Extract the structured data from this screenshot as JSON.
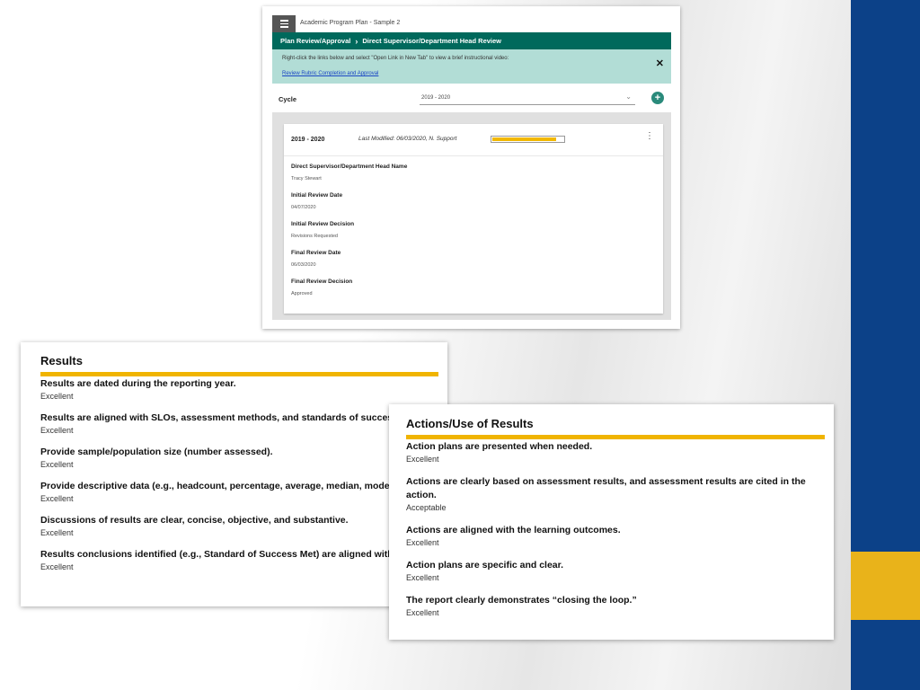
{
  "app": {
    "title": "Academic Program Plan - Sample 2",
    "breadcrumb": [
      "Plan Review/Approval",
      "Direct Supervisor/Department Head Review"
    ],
    "banner": {
      "text": "Right-click the links below and select \"Open Link in New Tab\" to view a brief instructional video:",
      "link": "Review Rubric Completion and Approval",
      "close_icon": "close-icon"
    },
    "cycle": {
      "label": "Cycle",
      "selected": "2019 - 2020",
      "add_icon": "add-circle-icon"
    },
    "card": {
      "year": "2019 - 2020",
      "last_modified": "Last Modified: 06/03/2020, N. Support",
      "progress": 0.9,
      "progress_color": "#f2b800",
      "fields": [
        {
          "label": "Direct Supervisor/Department Head Name",
          "value": "Tracy Stewart"
        },
        {
          "label": "Initial Review Date",
          "value": "04/07/2020"
        },
        {
          "label": "Initial Review Decision",
          "value": "Revisions Requested"
        },
        {
          "label": "Final Review Date",
          "value": "06/03/2020"
        },
        {
          "label": "Final Review Decision",
          "value": "Approved"
        }
      ]
    }
  },
  "results": {
    "title": "Results",
    "items": [
      {
        "title": "Results are dated during the reporting year.",
        "rating": "Excellent"
      },
      {
        "title": "Results are aligned with SLOs, assessment methods, and standards of success.",
        "rating": "Excellent"
      },
      {
        "title": "Provide sample/population size (number assessed).",
        "rating": "Excellent"
      },
      {
        "title": "Provide descriptive data (e.g., headcount, percentage, average, median, mode, etc.).",
        "rating": "Excellent"
      },
      {
        "title": "Discussions of results are clear, concise, objective, and substantive.",
        "rating": "Excellent"
      },
      {
        "title": "Results conclusions identified (e.g., Standard of Success Met) are aligned with the data provided.",
        "rating": "Excellent"
      }
    ]
  },
  "actions": {
    "title": "Actions/Use of Results",
    "items": [
      {
        "title": "Action plans are presented when needed.",
        "rating": "Excellent"
      },
      {
        "title": "Actions are clearly based on assessment results, and assessment results are cited in the action.",
        "rating": "Acceptable"
      },
      {
        "title": "Actions are aligned with the learning outcomes.",
        "rating": "Excellent"
      },
      {
        "title": "Action plans are specific and clear.",
        "rating": "Excellent"
      },
      {
        "title": "The report clearly demonstrates “closing the loop.”",
        "rating": "Excellent"
      }
    ]
  },
  "colors": {
    "brand_blue": "#0c4188",
    "brand_gold": "#e9b31a",
    "teal_bar": "#00695c",
    "banner_bg": "#b2ddd6",
    "rule_gold": "#f0b400"
  }
}
